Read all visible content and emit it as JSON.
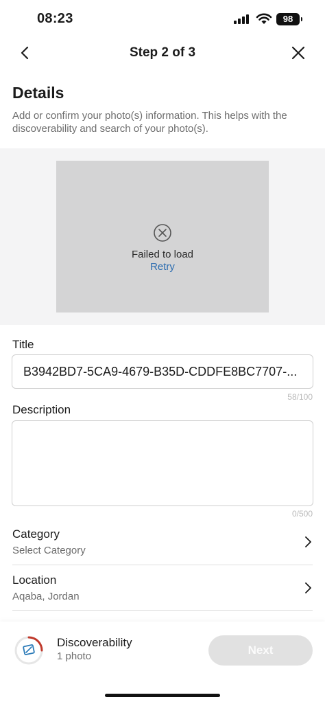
{
  "status_bar": {
    "time": "08:23",
    "battery": "98"
  },
  "nav": {
    "title": "Step 2 of 3"
  },
  "details": {
    "heading": "Details",
    "subtitle": "Add or confirm your photo(s) information. This helps with the discoverability and search of your photo(s)."
  },
  "photo": {
    "error_text": "Failed to load",
    "retry_label": "Retry"
  },
  "title_field": {
    "label": "Title",
    "value": "B3942BD7-5CA9-4679-B35D-CDDFE8BC7707-...",
    "counter": "58/100"
  },
  "description_field": {
    "label": "Description",
    "value": "",
    "counter": "0/500"
  },
  "category": {
    "label": "Category",
    "value": "Select Category"
  },
  "location": {
    "label": "Location",
    "value": "Aqaba, Jordan"
  },
  "footer": {
    "discoverability_title": "Discoverability",
    "discoverability_count": "1 photo",
    "next_label": "Next"
  },
  "colors": {
    "link": "#2b6cb0",
    "ring_accent": "#c0392b",
    "icon_blue": "#2a7ab8"
  }
}
